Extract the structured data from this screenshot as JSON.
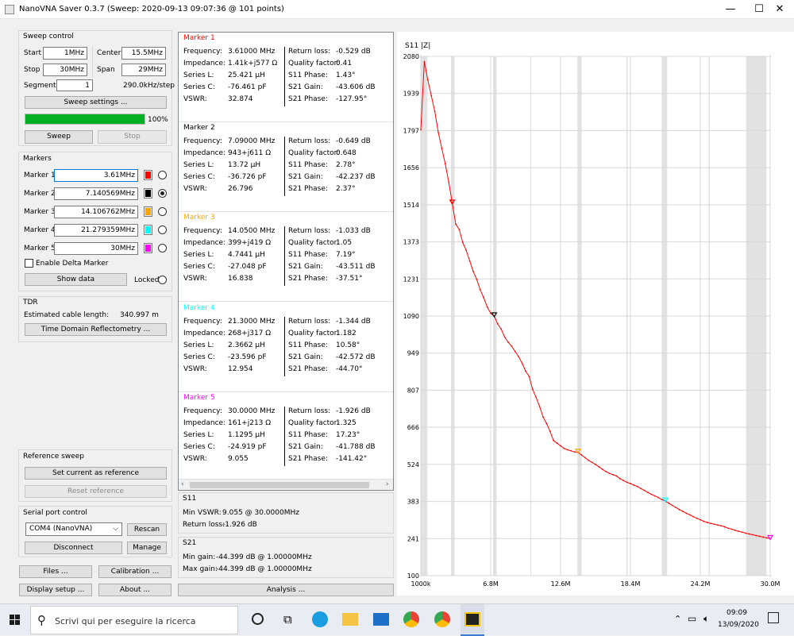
{
  "window": {
    "title": "NanoVNA Saver 0.3.7 (Sweep: 2020-09-13 09:07:36 @ 101 points)",
    "minimize": "—",
    "maximize": "☐",
    "close": "✕"
  },
  "sweep_control": {
    "title": "Sweep control",
    "start_label": "Start",
    "start": "1MHz",
    "center_label": "Center",
    "center": "15.5MHz",
    "stop_label": "Stop",
    "stop": "30MHz",
    "span_label": "Span",
    "span": "29MHz",
    "segments_label": "Segments",
    "segments": "1",
    "step": "290.0kHz/step",
    "settings_button": "Sweep settings ...",
    "progress": 1.0,
    "progress_text": "100%",
    "sweep_button": "Sweep",
    "stop_button": "Stop"
  },
  "markers_panel": {
    "title": "Markers",
    "items": [
      {
        "label": "Marker 1",
        "value": "3.61MHz",
        "color": "#ff0000",
        "selected": false
      },
      {
        "label": "Marker 2",
        "value": "7.140569MHz",
        "color": "#000000",
        "selected": true
      },
      {
        "label": "Marker 3",
        "value": "14.106762MHz",
        "color": "#ffa500",
        "selected": false
      },
      {
        "label": "Marker 4",
        "value": "21.279359MHz",
        "color": "#00ffff",
        "selected": false
      },
      {
        "label": "Marker 5",
        "value": "30MHz",
        "color": "#ff00ff",
        "selected": false
      }
    ],
    "delta_label": "Enable Delta Marker",
    "show_data": "Show data",
    "locked": "Locked"
  },
  "tdr": {
    "title": "TDR",
    "cable_label": "Estimated cable length:",
    "cable_value": "340.997 m",
    "button": "Time Domain Reflectometry ..."
  },
  "reference": {
    "title": "Reference sweep",
    "set_button": "Set current as reference",
    "reset_button": "Reset reference"
  },
  "serial": {
    "title": "Serial port control",
    "port": "COM4 (NanoVNA)",
    "rescan": "Rescan",
    "disconnect": "Disconnect",
    "manage": "Manage"
  },
  "bottom_buttons": {
    "files": "Files ...",
    "calibration": "Calibration ...",
    "display": "Display setup ...",
    "about": "About ...",
    "analysis": "Analysis ..."
  },
  "labels": {
    "frequency": "Frequency:",
    "impedance": "Impedance:",
    "series_l": "Series L:",
    "series_c": "Series C:",
    "vswr": "VSWR:",
    "return_loss": "Return loss:",
    "quality": "Quality factor:",
    "s11_phase": "S11 Phase:",
    "s21_gain": "S21 Gain:",
    "s21_phase": "S21 Phase:",
    "min_vswr": "Min VSWR:",
    "min_gain": "Min gain:",
    "max_gain": "Max gain:"
  },
  "marker_details": [
    {
      "title": "Marker 1",
      "color": "#ff0000",
      "frequency": "3.61000 MHz",
      "impedance": "1.41k+j577 Ω",
      "series_l": "25.421 µH",
      "series_c": "-76.461 pF",
      "vswr": "32.874",
      "return_loss": "-0.529 dB",
      "quality": "0.41",
      "s11_phase": "1.43°",
      "s21_gain": "-43.606 dB",
      "s21_phase": "-127.95°"
    },
    {
      "title": "Marker 2",
      "color": "#000000",
      "frequency": "7.09000 MHz",
      "impedance": "943+j611 Ω",
      "series_l": "13.72 µH",
      "series_c": "-36.726 pF",
      "vswr": "26.796",
      "return_loss": "-0.649 dB",
      "quality": "0.648",
      "s11_phase": "2.78°",
      "s21_gain": "-42.237 dB",
      "s21_phase": "2.37°"
    },
    {
      "title": "Marker 3",
      "color": "#ffa500",
      "frequency": "14.0500 MHz",
      "impedance": "399+j419 Ω",
      "series_l": "4.7441 µH",
      "series_c": "-27.048 pF",
      "vswr": "16.838",
      "return_loss": "-1.033 dB",
      "quality": "1.05",
      "s11_phase": "7.19°",
      "s21_gain": "-43.511 dB",
      "s21_phase": "-37.51°"
    },
    {
      "title": "Marker 4",
      "color": "#00ffff",
      "frequency": "21.3000 MHz",
      "impedance": "268+j317 Ω",
      "series_l": "2.3662 µH",
      "series_c": "-23.596 pF",
      "vswr": "12.954",
      "return_loss": "-1.344 dB",
      "quality": "1.182",
      "s11_phase": "10.58°",
      "s21_gain": "-42.572 dB",
      "s21_phase": "-44.70°"
    },
    {
      "title": "Marker 5",
      "color": "#ff00ff",
      "frequency": "30.0000 MHz",
      "impedance": "161+j213 Ω",
      "series_l": "1.1295 µH",
      "series_c": "-24.919 pF",
      "vswr": "9.055",
      "return_loss": "-1.926 dB",
      "quality": "1.325",
      "s11_phase": "17.23°",
      "s21_gain": "-41.788 dB",
      "s21_phase": "-141.42°"
    }
  ],
  "s11_summary": {
    "title": "S11",
    "min_vswr": "9.055 @ 30.0000MHz",
    "return_loss": "-1.926 dB"
  },
  "s21_summary": {
    "title": "S21",
    "min_gain": "-44.399 dB @ 1.00000MHz",
    "max_gain": "-44.399 dB @ 1.00000MHz"
  },
  "taskbar": {
    "search_placeholder": "Scrivi qui per eseguire la ricerca",
    "time": "09:09",
    "date": "13/09/2020"
  },
  "chart_data": {
    "type": "line",
    "title": "S11 |Z|",
    "x_ticks": [
      "1000k",
      "6.8M",
      "12.6M",
      "18.4M",
      "24.2M",
      "30.0M"
    ],
    "y_ticks": [
      "2080",
      "1939",
      "1797",
      "1656",
      "1514",
      "1373",
      "1231",
      "1090",
      "949",
      "807",
      "666",
      "524",
      "383",
      "241",
      "100"
    ],
    "xlim": [
      1.0,
      30.0
    ],
    "ylim": [
      100,
      2080
    ],
    "color": "#ff0000",
    "grid": true,
    "x": [
      1.0,
      1.29,
      1.58,
      1.87,
      2.16,
      2.45,
      2.74,
      3.03,
      3.32,
      3.61,
      3.9,
      4.19,
      4.48,
      4.77,
      5.06,
      5.35,
      5.64,
      5.93,
      6.22,
      6.51,
      6.8,
      7.09,
      7.38,
      7.67,
      7.96,
      8.25,
      8.54,
      8.83,
      9.12,
      9.41,
      9.7,
      9.99,
      10.28,
      10.57,
      10.86,
      11.15,
      11.44,
      11.73,
      12.02,
      12.31,
      12.6,
      12.89,
      13.18,
      13.47,
      13.76,
      14.05,
      14.34,
      14.63,
      14.92,
      15.21,
      15.5,
      15.79,
      16.08,
      16.37,
      16.66,
      16.95,
      17.24,
      17.53,
      17.82,
      18.11,
      18.4,
      18.69,
      18.98,
      19.27,
      19.56,
      19.85,
      20.14,
      20.43,
      20.72,
      21.01,
      21.3,
      21.59,
      21.88,
      22.17,
      22.46,
      22.75,
      23.04,
      23.33,
      23.62,
      23.91,
      24.2,
      24.49,
      24.78,
      25.07,
      25.36,
      25.65,
      25.94,
      26.23,
      26.52,
      26.81,
      27.1,
      27.39,
      27.68,
      27.97,
      28.26,
      28.55,
      28.84,
      29.13,
      29.42,
      29.71,
      30.0
    ],
    "values": [
      1800,
      2060,
      1990,
      1930,
      1870,
      1790,
      1730,
      1670,
      1600,
      1520,
      1440,
      1420,
      1370,
      1340,
      1300,
      1260,
      1230,
      1190,
      1160,
      1125,
      1100,
      1090,
      1060,
      1040,
      1010,
      990,
      975,
      955,
      935,
      910,
      880,
      860,
      810,
      780,
      745,
      705,
      680,
      650,
      615,
      605,
      595,
      585,
      580,
      576,
      572,
      570,
      560,
      550,
      540,
      532,
      524,
      515,
      505,
      497,
      490,
      485,
      480,
      470,
      463,
      456,
      451,
      445,
      440,
      432,
      425,
      417,
      410,
      404,
      398,
      390,
      384,
      376,
      368,
      360,
      352,
      345,
      338,
      332,
      325,
      319,
      313,
      307,
      303,
      299,
      296,
      293,
      290,
      286,
      281,
      277,
      273,
      269,
      266,
      262,
      259,
      256,
      253,
      250,
      247,
      244,
      241
    ],
    "markers": [
      {
        "x": 3.61,
        "y": 1520,
        "color": "#ff0000"
      },
      {
        "x": 7.09,
        "y": 1090,
        "color": "#000000"
      },
      {
        "x": 14.05,
        "y": 570,
        "color": "#ffa500"
      },
      {
        "x": 21.3,
        "y": 384,
        "color": "#00ffff"
      },
      {
        "x": 30.0,
        "y": 241,
        "color": "#ff00ff"
      }
    ]
  }
}
